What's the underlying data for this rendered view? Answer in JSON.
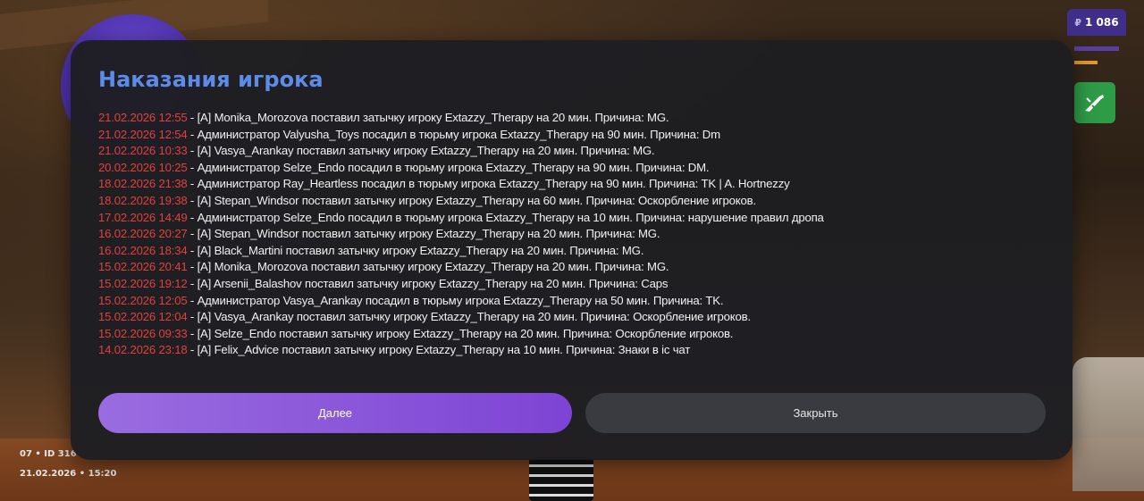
{
  "hud": {
    "currency_symbol": "₽",
    "money": "1 086",
    "weapon_icon": "rifle-icon"
  },
  "footer": {
    "line1": "07 • ID 316",
    "line2": "21.02.2026 • 15:20"
  },
  "modal": {
    "title": "Наказания игрока",
    "entries": [
      {
        "date": "21.02.2026 12:55",
        "text": " - [A] Monika_Morozova поставил затычку игроку Extazzy_Therapy на 20 мин. Причина: MG."
      },
      {
        "date": "21.02.2026 12:54",
        "text": " - Администратор Valyusha_Toys посадил в тюрьму игрока Extazzy_Therapy на 90 мин. Причина: Dm"
      },
      {
        "date": "21.02.2026 10:33",
        "text": " - [A] Vasya_Arankay поставил затычку игроку Extazzy_Therapy на 20 мин. Причина: MG."
      },
      {
        "date": "20.02.2026 10:25",
        "text": " - Администратор Selze_Endo посадил в тюрьму игрока Extazzy_Therapy на 90 мин. Причина: DM."
      },
      {
        "date": "18.02.2026 21:38",
        "text": " - Администратор Ray_Heartless посадил в тюрьму игрока Extazzy_Therapy на 90 мин. Причина: TK | A. Hortnezzy"
      },
      {
        "date": "18.02.2026 19:38",
        "text": " - [A] Stepan_Windsor поставил затычку игроку Extazzy_Therapy на 60 мин. Причина: Оскорбление игроков."
      },
      {
        "date": "17.02.2026 14:49",
        "text": " - Администратор Selze_Endo посадил в тюрьму игрока Extazzy_Therapy на 10 мин. Причина: нарушение правил дропа"
      },
      {
        "date": "16.02.2026 20:27",
        "text": " - [A] Stepan_Windsor поставил затычку игроку Extazzy_Therapy на 20 мин. Причина: MG."
      },
      {
        "date": "16.02.2026 18:34",
        "text": " - [A] Black_Martini поставил затычку игроку Extazzy_Therapy на 20 мин. Причина: MG."
      },
      {
        "date": "15.02.2026 20:41",
        "text": " - [A] Monika_Morozova поставил затычку игроку Extazzy_Therapy на 20 мин. Причина: MG."
      },
      {
        "date": "15.02.2026 19:12",
        "text": " - [A] Arsenii_Balashov поставил затычку игроку Extazzy_Therapy на 20 мин. Причина: Caps"
      },
      {
        "date": "15.02.2026 12:05",
        "text": " - Администратор Vasya_Arankay посадил в тюрьму игрока Extazzy_Therapy на 50 мин. Причина: TK."
      },
      {
        "date": "15.02.2026 12:04",
        "text": " - [A] Vasya_Arankay поставил затычку игроку Extazzy_Therapy на 20 мин. Причина: Оскорбление игроков."
      },
      {
        "date": "15.02.2026 09:33",
        "text": " - [A] Selze_Endo поставил затычку игроку Extazzy_Therapy на 20 мин. Причина: Оскорбление игроков."
      },
      {
        "date": "14.02.2026 23:18",
        "text": " - [A] Felix_Advice поставил затычку игроку Extazzy_Therapy на 10 мин. Причина: Знаки в ic чат"
      }
    ],
    "next_label": "Далее",
    "close_label": "Закрыть"
  },
  "colors": {
    "title": "#5c8be8",
    "date": "#e0413f",
    "next_button": "#8a55da",
    "close_button": "#3a3b40"
  }
}
